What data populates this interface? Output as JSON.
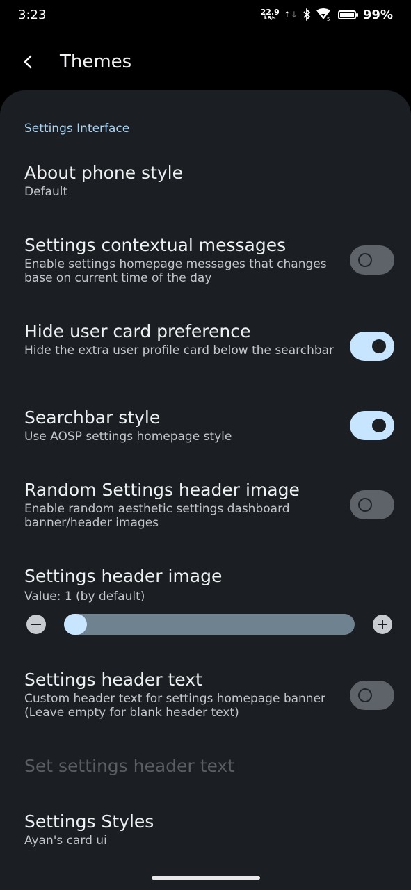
{
  "status_bar": {
    "time": "3:23",
    "net_speed_value": "22.9",
    "net_speed_unit": "kB/s",
    "wifi_badge": "5",
    "battery_pct": "99%",
    "icons": [
      "network-speed-icon",
      "bluetooth-icon",
      "wifi-icon",
      "battery-icon"
    ]
  },
  "header": {
    "title": "Themes",
    "back_icon": "back-chevron-icon"
  },
  "section": {
    "header": "Settings Interface"
  },
  "prefs": {
    "about_phone": {
      "title": "About phone style",
      "summary": "Default"
    },
    "contextual": {
      "title": "Settings contextual messages",
      "summary": "Enable settings homepage messages that changes base on current time of the day",
      "enabled": false
    },
    "hide_user_card": {
      "title": "Hide user card preference",
      "summary": "Hide the extra user profile card below the searchbar",
      "enabled": true
    },
    "searchbar": {
      "title": "Searchbar style",
      "summary": "Use AOSP settings homepage style",
      "enabled": true
    },
    "random_header": {
      "title": "Random Settings header image",
      "summary": "Enable random aesthetic settings dashboard banner/header images",
      "enabled": false
    },
    "header_image": {
      "title": "Settings header image",
      "summary": "Value: 1 (by default)",
      "value": 1
    },
    "header_text": {
      "title": "Settings header text",
      "summary": "Custom header text for settings homepage banner (Leave empty for blank header text)",
      "enabled": false
    },
    "set_header_text": {
      "title": "Set settings header text",
      "disabled": true
    },
    "styles": {
      "title": "Settings Styles",
      "summary": "Ayan's card ui"
    }
  },
  "colors": {
    "background": "#000000",
    "sheet": "#1b1e22",
    "accent": "#c7e5ff",
    "section_header": "#a8d3f2",
    "toggle_off": "#5e6369"
  }
}
